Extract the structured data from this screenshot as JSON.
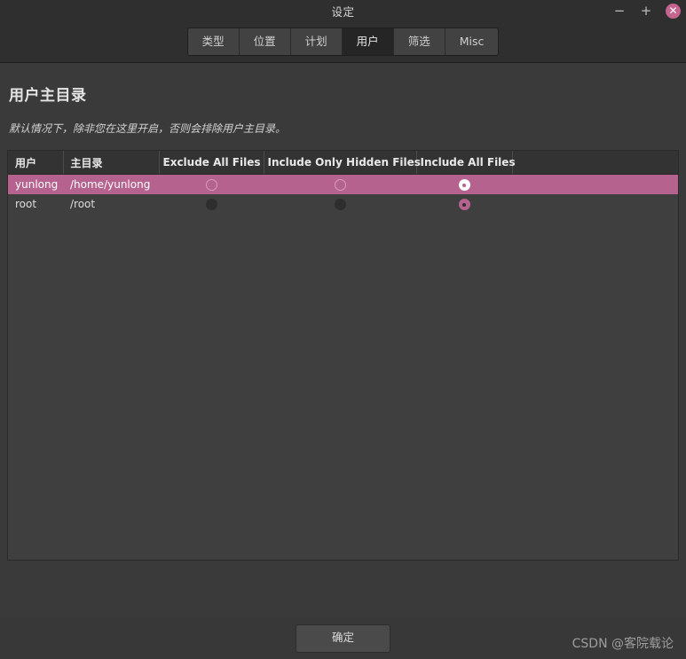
{
  "window": {
    "title": "设定",
    "controls": {
      "minimize": "−",
      "maximize": "+",
      "close": "✕"
    }
  },
  "tabs": [
    {
      "label": "类型",
      "active": false
    },
    {
      "label": "位置",
      "active": false
    },
    {
      "label": "计划",
      "active": false
    },
    {
      "label": "用户",
      "active": true
    },
    {
      "label": "筛选",
      "active": false
    },
    {
      "label": "Misc",
      "active": false
    }
  ],
  "page": {
    "title": "用户主目录",
    "description": "默认情况下，除非您在这里开启，否则会排除用户主目录。"
  },
  "table": {
    "columns": [
      "用户",
      "主目录",
      "Exclude All Files",
      "Include Only Hidden Files",
      "Include All Files"
    ],
    "rows": [
      {
        "user": "yunlong",
        "home": "/home/yunlong",
        "exclude_all": false,
        "include_hidden_only": false,
        "include_all": true,
        "selected": true
      },
      {
        "user": "root",
        "home": "/root",
        "exclude_all": false,
        "include_hidden_only": false,
        "include_all": true,
        "selected": false
      }
    ]
  },
  "footer": {
    "ok_label": "确定",
    "watermark": "CSDN @客院载论"
  },
  "colors": {
    "accent": "#b5628e",
    "window_bg": "#383838",
    "content_bg": "#3a3a3a",
    "table_bg": "#3f3f3f",
    "header_bg": "#333333",
    "tab_bg": "#424242",
    "tab_active_bg": "#252525"
  }
}
